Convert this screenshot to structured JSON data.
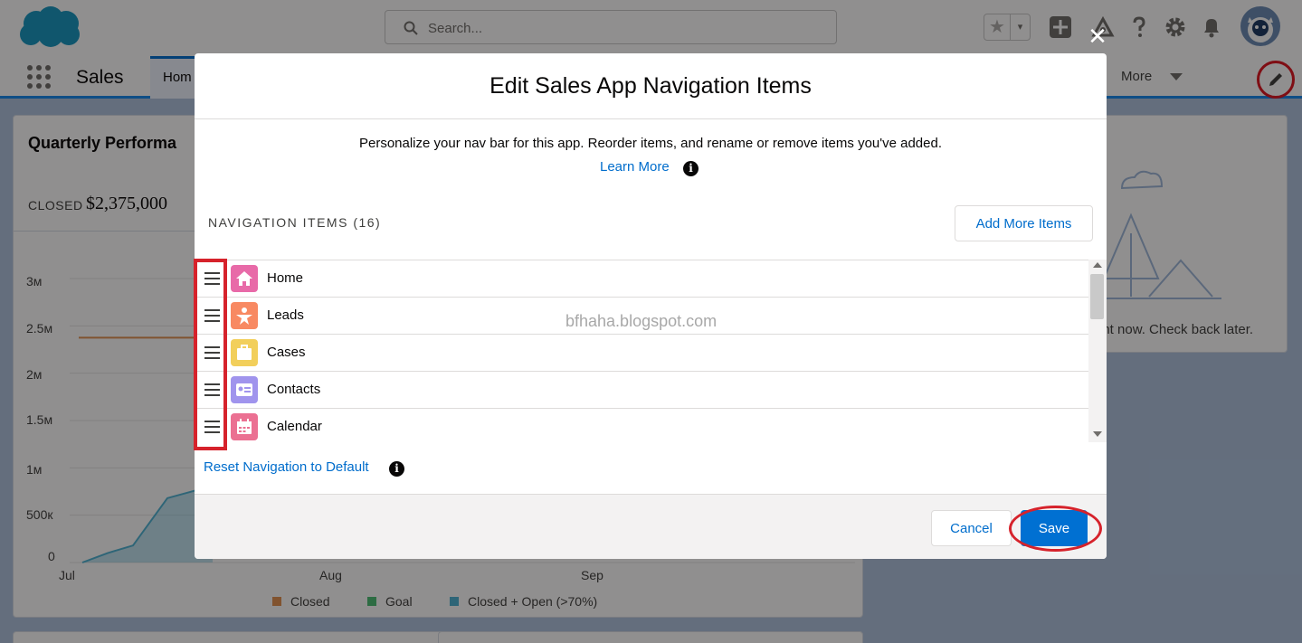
{
  "header": {
    "search_placeholder": "Search...",
    "favorites_star": "★",
    "favorites_caret": "▾",
    "icons": [
      "add-icon",
      "trailhead-icon",
      "help-icon",
      "gear-icon",
      "bell-icon"
    ]
  },
  "nav": {
    "app_name": "Sales",
    "tab_home": "Hom",
    "more_label": "More",
    "edit_icon": "pencil-icon",
    "accent_color": "#1589ee"
  },
  "dashboard": {
    "title": "Quarterly Performa",
    "closed_label": "CLOSED",
    "closed_value": "$2,375,000",
    "right_message": "ght now. Check back later."
  },
  "chart_data": {
    "type": "line",
    "x_ticks": [
      "Jul",
      "Aug",
      "Sep"
    ],
    "y_ticks": [
      "3м",
      "2.5м",
      "2м",
      "1.5м",
      "1м",
      "500к",
      "0"
    ],
    "ylim": [
      0,
      3000000
    ],
    "series": [
      {
        "name": "Closed",
        "color": "#e39250",
        "values": [
          2375000,
          2375000
        ]
      },
      {
        "name": "Goal",
        "color": "#4bc076",
        "values": []
      },
      {
        "name": "Closed + Open (>70%)",
        "color": "#4db3d4",
        "values": [
          0,
          100000,
          180000,
          680000,
          810000
        ]
      }
    ]
  },
  "modal": {
    "close_glyph": "✕",
    "title": "Edit Sales App Navigation Items",
    "intro": "Personalize your nav bar for this app. Reorder items, and rename or remove items you've added.",
    "learn_more": "Learn More",
    "info_glyph": "i",
    "nav_items_label": "NAVIGATION ITEMS (16)",
    "add_more_label": "Add More Items",
    "items": [
      {
        "label": "Home",
        "icon": "home-icon",
        "color": "#e86aa8"
      },
      {
        "label": "Leads",
        "icon": "lead-icon",
        "color": "#f88962"
      },
      {
        "label": "Cases",
        "icon": "case-icon",
        "color": "#f2cf5b"
      },
      {
        "label": "Contacts",
        "icon": "contact-icon",
        "color": "#a094ed"
      },
      {
        "label": "Calendar",
        "icon": "calendar-icon",
        "color": "#eb7092"
      }
    ],
    "watermark": "bfhaha.blogspot.com",
    "reset_label": "Reset Navigation to Default",
    "cancel_label": "Cancel",
    "save_label": "Save",
    "primary_color": "#0070d2"
  }
}
